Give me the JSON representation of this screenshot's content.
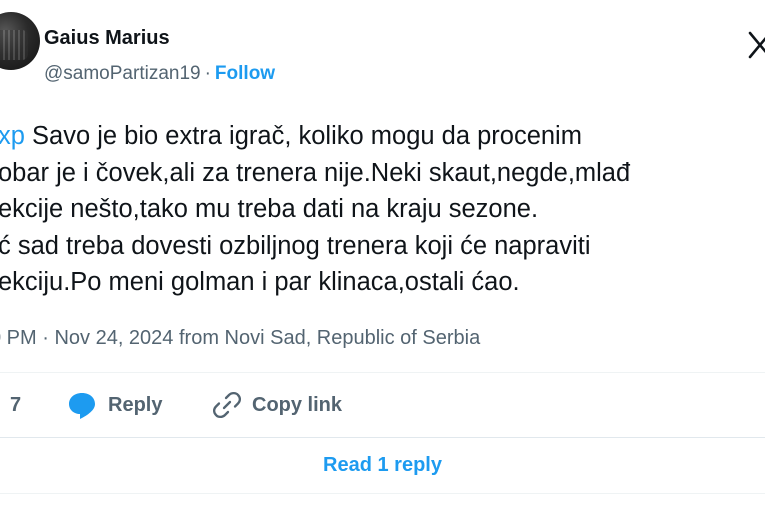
{
  "author": {
    "display_name": "Gaius Marius",
    "handle": "@samoPartizan19",
    "separator": "·",
    "follow_label": "Follow"
  },
  "tweet": {
    "mention": "xp",
    "lines": [
      " Savo je bio extra igrač, koliko mogu da procenim",
      "obar je i čovek,ali za trenera nije.Neki skaut,negde,mlađ",
      "ekcije nešto,tako mu treba dati na kraju sezone.",
      "ć sad treba dovesti ozbiljnog trenera koji će napraviti",
      "ekciju.Po meni golman i par klinaca,ostali ćao."
    ],
    "timestamp": "0 PM · Nov 24, 2024 from Novi Sad, Republic of Serbia"
  },
  "actions": {
    "like_count": "7",
    "reply_label": "Reply",
    "copy_link_label": "Copy link"
  },
  "read_reply_label": "Read 1 reply",
  "colors": {
    "accent": "#1d9bf0",
    "text": "#0f1419",
    "secondary": "#536471"
  }
}
